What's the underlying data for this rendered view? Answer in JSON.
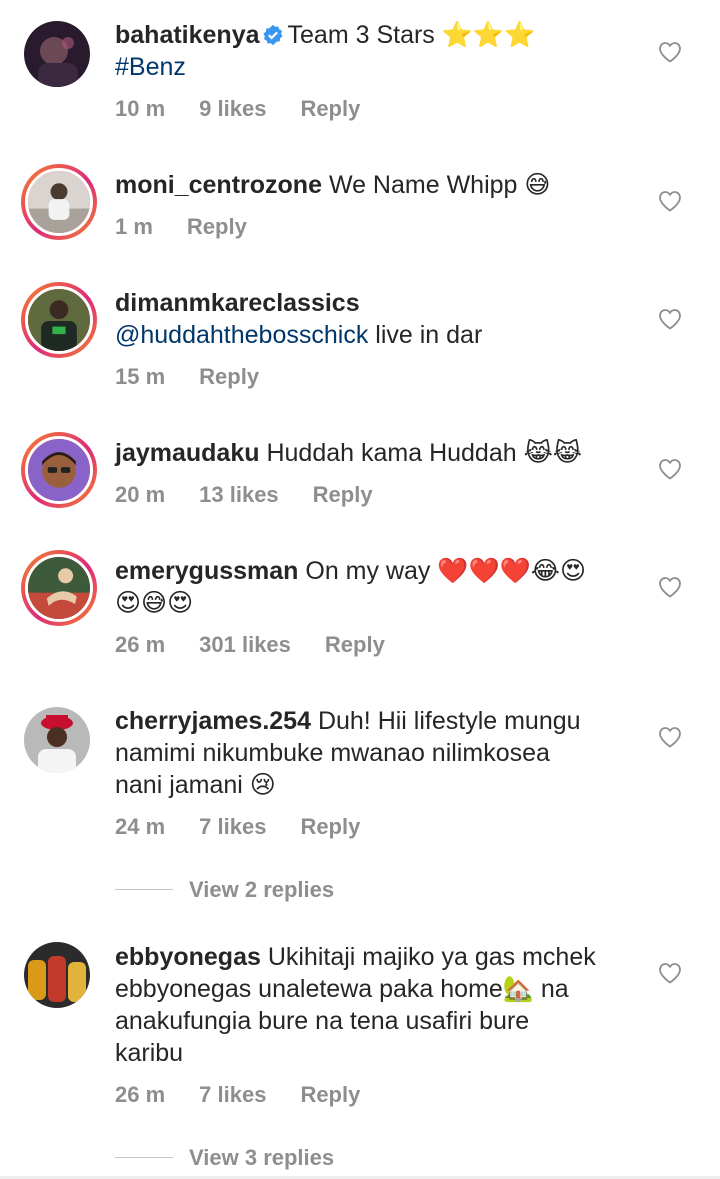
{
  "comments": [
    {
      "username": "bahatikenya",
      "verified": true,
      "text": "Team 3 Stars ⭐⭐⭐",
      "text2": "#Benz",
      "time": "10 m",
      "likes": "9 likes",
      "reply": "Reply",
      "avatar_style": "plain"
    },
    {
      "username": "moni_centrozone",
      "text": "We Name Whipp 😅",
      "time": "1 m",
      "reply": "Reply",
      "avatar_style": "story-ring"
    },
    {
      "username": "dimanmkareclassics",
      "mention": "@huddahthebosschick",
      "text": " live in dar",
      "time": "15 m",
      "reply": "Reply",
      "avatar_style": "story-ring"
    },
    {
      "username": "jaymaudaku",
      "text": "Huddah kama Huddah 😹😹",
      "time": "20 m",
      "likes": "13 likes",
      "reply": "Reply",
      "avatar_style": "story-ring"
    },
    {
      "username": "emerygussman",
      "text": "On my way ❤️❤️❤️😂😍",
      "text2": "😍😅😍",
      "time": "26 m",
      "likes": "301 likes",
      "reply": "Reply",
      "avatar_style": "story-ring"
    },
    {
      "username": "cherryjames.254",
      "text": "Duh! Hii lifestyle mungu",
      "text2": "namimi nikumbuke mwanao nilimkosea",
      "text3": "nani jamani 😢",
      "time": "24 m",
      "likes": "7 likes",
      "reply": "Reply",
      "view_replies": "View 2 replies",
      "avatar_style": "plain"
    },
    {
      "username": "ebbyonegas",
      "text": "Ukihitaji majiko ya gas mchek",
      "text2": "ebbyonegas unaletewa paka home🏡 na",
      "text3": "anakufungia bure na tena usafiri bure",
      "text4": "karibu",
      "time": "26 m",
      "likes": "7 likes",
      "reply": "Reply",
      "view_replies": "View 3 replies",
      "avatar_style": "plain"
    }
  ],
  "colors": {
    "text": "#262626",
    "meta": "#8e8e8e",
    "mention": "#00376b",
    "verified": "#3897f0",
    "ring_start": "#f58529",
    "ring_mid": "#dd2a7b"
  },
  "icons": {
    "like": "heart-outline-icon",
    "verified": "verified-badge-icon"
  }
}
